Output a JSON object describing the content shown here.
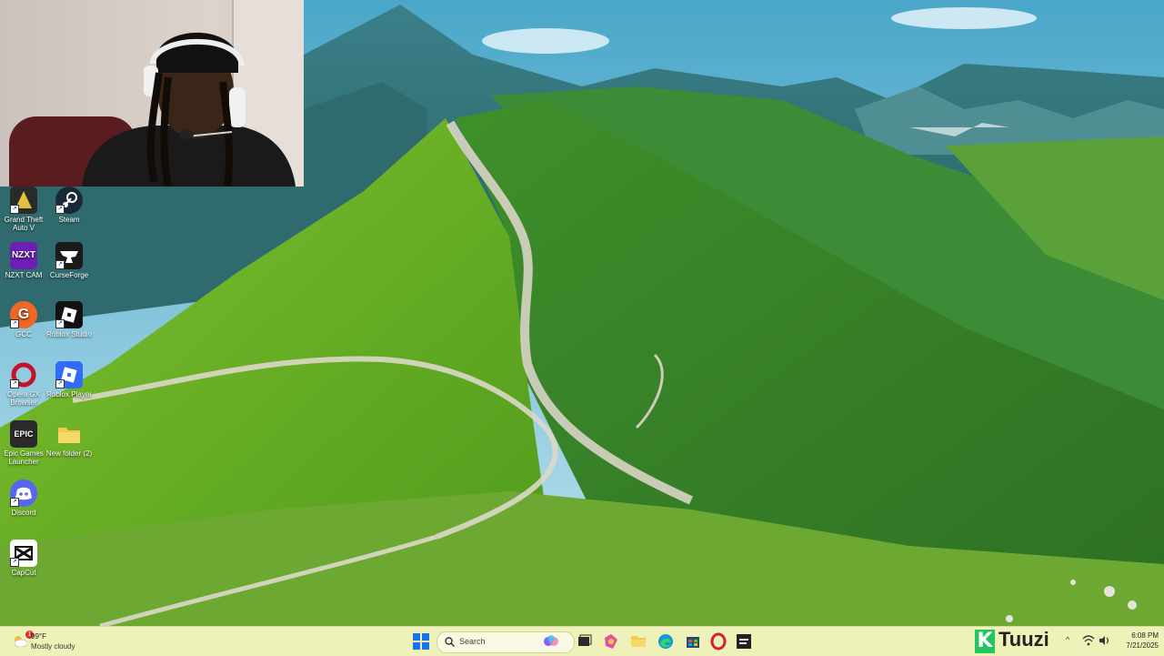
{
  "desktop": {
    "icons": [
      {
        "label": "Grand Theft Auto V",
        "icon": "gta-icon",
        "color": "#2a2a2a"
      },
      {
        "label": "Steam",
        "icon": "steam-icon",
        "color": "#1b2838"
      },
      {
        "label": "NZXT CAM",
        "icon": "nzxt-icon",
        "color": "#6b1fb5",
        "text": "NZXT"
      },
      {
        "label": "CurseForge",
        "icon": "curseforge-icon",
        "color": "#1a1a1a"
      },
      {
        "label": "GCC",
        "icon": "gcc-icon",
        "color": "#f26522"
      },
      {
        "label": "Roblox Studio",
        "icon": "roblox-studio-icon",
        "color": "#111111"
      },
      {
        "label": "Opera GX Browser",
        "icon": "opera-gx-icon",
        "color": "#c8102e"
      },
      {
        "label": "Roblox Player",
        "icon": "roblox-player-icon",
        "color": "#2f6bff"
      },
      {
        "label": "Epic Games Launcher",
        "icon": "epic-games-icon",
        "color": "#2b2b2b",
        "text": "EPIC"
      },
      {
        "label": "New folder (2)",
        "icon": "folder-icon",
        "color": "#f2c94c"
      },
      {
        "label": "Discord",
        "icon": "discord-icon",
        "color": "#5865f2"
      },
      {
        "label": "CapCut",
        "icon": "capcut-icon",
        "color": "#ffffff"
      }
    ]
  },
  "taskbar": {
    "weather": {
      "temp": "99°F",
      "condition": "Mostly cloudy",
      "alert_count": "1"
    },
    "search_placeholder": "Search",
    "apps": [
      {
        "icon": "copilot-icon",
        "color": "#7b61ff"
      },
      {
        "icon": "task-view-icon",
        "color": "#2b2b2b"
      },
      {
        "icon": "photos-icon",
        "color": "#e84fa3"
      },
      {
        "icon": "file-explorer-icon",
        "color": "#f2c94c"
      },
      {
        "icon": "edge-icon",
        "color": "#0f9ad6"
      },
      {
        "icon": "store-icon",
        "color": "#1f4e79"
      },
      {
        "icon": "opera-gx-icon",
        "color": "#d6202f"
      },
      {
        "icon": "app-icon",
        "color": "#222222"
      }
    ],
    "brand": "Tuuzi",
    "clock": {
      "time": "6:08 PM",
      "date": "7/21/2025"
    }
  }
}
